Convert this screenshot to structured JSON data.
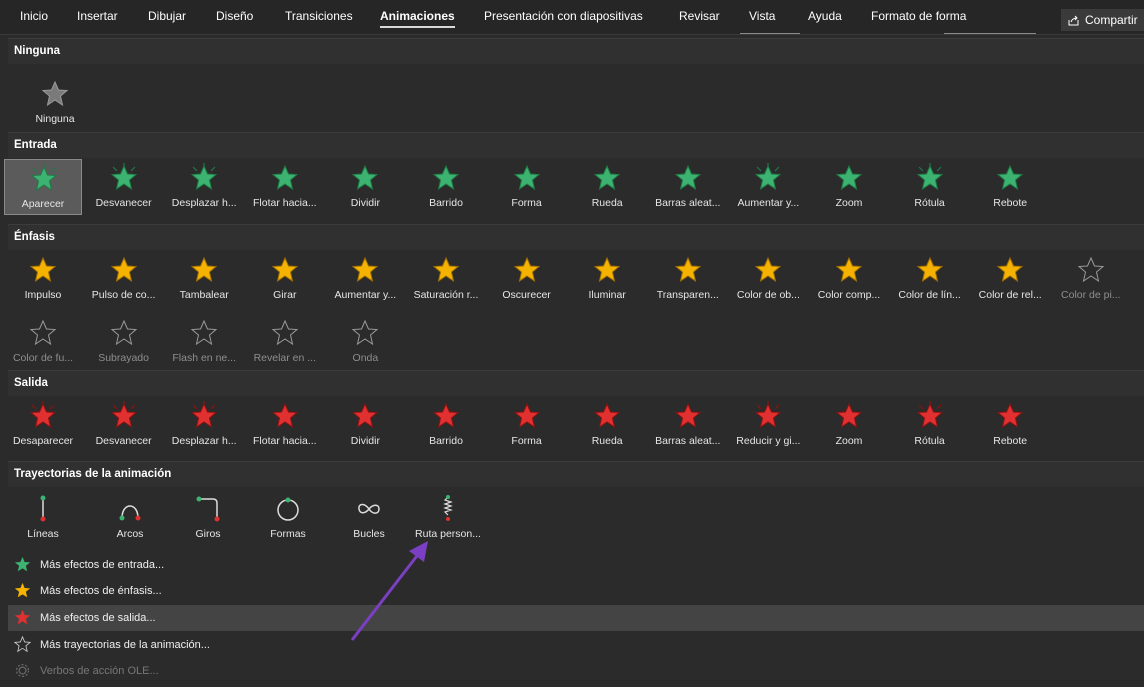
{
  "ribbon": {
    "tabs": [
      "Inicio",
      "Insertar",
      "Dibujar",
      "Diseño",
      "Transiciones",
      "Animaciones",
      "Presentación con diapositivas",
      "Revisar",
      "Vista",
      "Ayuda",
      "Formato de forma"
    ],
    "active_tab": "Animaciones",
    "share_label": "Compartir"
  },
  "sections": {
    "none": {
      "title": "Ninguna",
      "items": [
        "Ninguna"
      ]
    },
    "entrance": {
      "title": "Entrada",
      "items": [
        "Aparecer",
        "Desvanecer",
        "Desplazar h...",
        "Flotar hacia...",
        "Dividir",
        "Barrido",
        "Forma",
        "Rueda",
        "Barras aleat...",
        "Aumentar y...",
        "Zoom",
        "Rótula",
        "Rebote"
      ],
      "selected": "Aparecer"
    },
    "emphasis": {
      "title": "Énfasis",
      "items": [
        "Impulso",
        "Pulso de co...",
        "Tambalear",
        "Girar",
        "Aumentar y...",
        "Saturación r...",
        "Oscurecer",
        "Iluminar",
        "Transparen...",
        "Color de ob...",
        "Color comp...",
        "Color de lín...",
        "Color de rel...",
        "Color de pi...",
        "Color de fu...",
        "Subrayado",
        "Flash en ne...",
        "Revelar en ...",
        "Onda"
      ]
    },
    "exit": {
      "title": "Salida",
      "items": [
        "Desaparecer",
        "Desvanecer",
        "Desplazar h...",
        "Flotar hacia...",
        "Dividir",
        "Barrido",
        "Forma",
        "Rueda",
        "Barras aleat...",
        "Reducir y gi...",
        "Zoom",
        "Rótula",
        "Rebote"
      ]
    },
    "paths": {
      "title": "Trayectorias de la animación",
      "items": [
        "Líneas",
        "Arcos",
        "Giros",
        "Formas",
        "Bucles",
        "Ruta person..."
      ]
    }
  },
  "menu": [
    {
      "label": "Más efectos de entrada...",
      "icon": "green-star-icon"
    },
    {
      "label": "Más efectos de énfasis...",
      "icon": "gold-star-icon"
    },
    {
      "label": "Más efectos de salida...",
      "icon": "red-star-icon"
    },
    {
      "label": "Más trayectorias de la animación...",
      "icon": "outline-star-icon"
    },
    {
      "label": "Verbos de acción OLE...",
      "icon": "gear-icon"
    }
  ],
  "colors": {
    "entrance": "#3cb371",
    "emphasis": "#f5b300",
    "exit": "#e03030",
    "annotation_arrow": "#7b3fc4"
  }
}
